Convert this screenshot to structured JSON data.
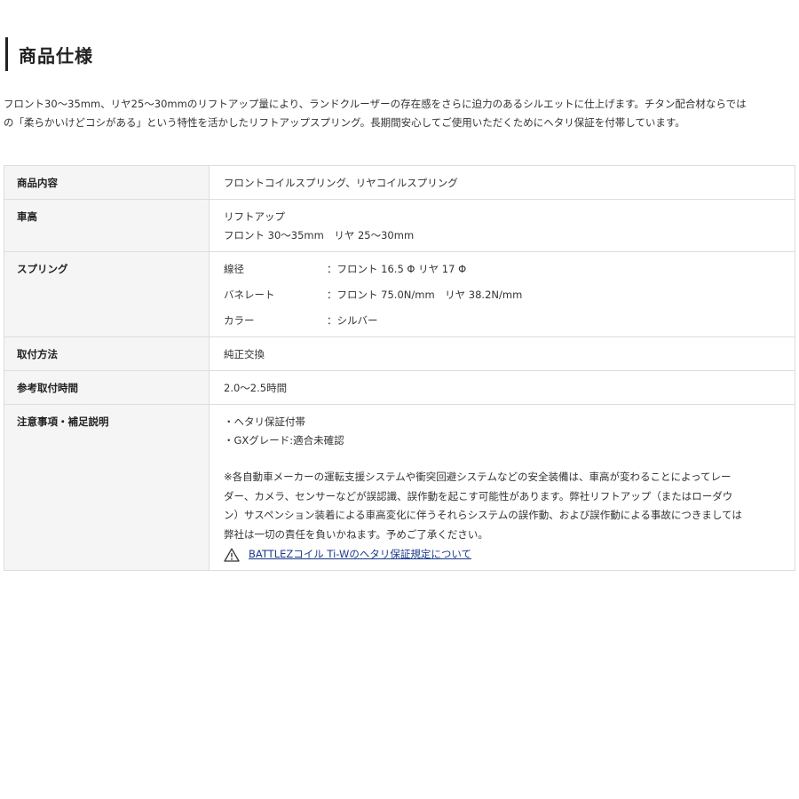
{
  "heading": "商品仕様",
  "intro": {
    "line1": "フロント30〜35mm、リヤ25〜30mmのリフトアップ量により、ランドクルーザーの存在感をさらに迫力のあるシルエットに仕上げます。チタン配合材ならでは",
    "line2": "の「柔らかいけどコシがある」という特性を活かしたリフトアップスプリング。長期間安心してご使用いただくためにヘタリ保証を付帯しています。"
  },
  "spec": {
    "contents": {
      "label": "商品内容",
      "value": "フロントコイルスプリング、リヤコイルスプリング"
    },
    "height": {
      "label": "車高",
      "line1": "リフトアップ",
      "line2": "フロント 30〜35mm　リヤ 25〜30mm"
    },
    "spring": {
      "label": "スプリング",
      "rows": [
        {
          "key": "線径",
          "value": "：フロント 16.5 Φ リヤ 17 Φ"
        },
        {
          "key": "バネレート",
          "value": "：フロント 75.0N/mm　リヤ 38.2N/mm"
        },
        {
          "key": "カラー",
          "value": "：シルバー"
        }
      ]
    },
    "method": {
      "label": "取付方法",
      "value": "純正交換"
    },
    "time": {
      "label": "参考取付時間",
      "value": "2.0〜2.5時間"
    },
    "notes": {
      "label": "注意事項・補足説明",
      "item1": "・ヘタリ保証付帯",
      "item2": "・GXグレード:適合未確認",
      "notice": [
        "※各自動車メーカーの運転支援システムや衝突回避システムなどの安全装備は、車高が変わることによってレー",
        "ダー、カメラ、センサーなどが誤認識、誤作動を起こす可能性があります。弊社リフトアップ（またはローダウ",
        "ン）サスペンション装着による車高変化に伴うそれらシステムの誤作動、および誤作動による事故につきましては",
        "弊社は一切の責任を負いかねます。予めご了承ください。"
      ],
      "link_text": "BATTLEZコイル Ti-Wのヘタリ保証規定について",
      "link_icon": "warning-triangle-icon"
    }
  }
}
